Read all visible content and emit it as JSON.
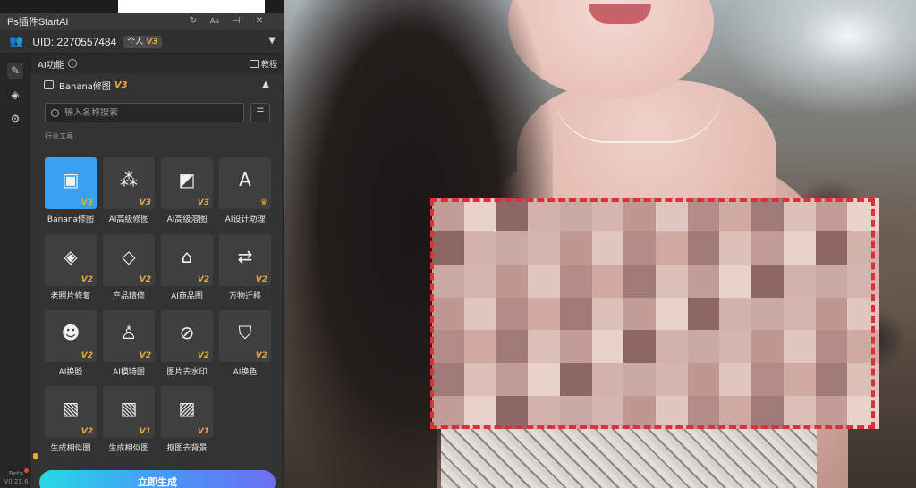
{
  "window": {
    "title": "Ps插件StartAI"
  },
  "user": {
    "uid_label": "UID: 2270557484",
    "plan_label": "个人",
    "plan_version": "V3"
  },
  "ai_panel": {
    "title": "AI功能",
    "info_glyph": "i",
    "tutorial_label": "教程",
    "section_name": "Banana修图",
    "section_version": "V3",
    "search_placeholder": "输入名称搜索",
    "category_label": "行业工具",
    "tools": [
      {
        "label": "Banana修图",
        "version": "V3",
        "icon": "image-edit-icon",
        "glyph": "▣",
        "selected": true
      },
      {
        "label": "AI高级修图",
        "version": "V3",
        "icon": "magic-wand-icon",
        "glyph": "⁂"
      },
      {
        "label": "AI高级溶图",
        "version": "V3",
        "icon": "image-blend-icon",
        "glyph": "◩"
      },
      {
        "label": "AI设计助理",
        "version": "",
        "icon": "design-assistant-icon",
        "glyph": "A"
      },
      {
        "label": "老照片修复",
        "version": "V2",
        "icon": "photo-restore-icon",
        "glyph": "◈"
      },
      {
        "label": "产品精修",
        "version": "V2",
        "icon": "diamond-icon",
        "glyph": "◇"
      },
      {
        "label": "AI商品图",
        "version": "V2",
        "icon": "shopping-bag-icon",
        "glyph": "⌂"
      },
      {
        "label": "万物迁移",
        "version": "V2",
        "icon": "transfer-icon",
        "glyph": "⇄"
      },
      {
        "label": "AI换脸",
        "version": "V2",
        "icon": "face-swap-icon",
        "glyph": "☻"
      },
      {
        "label": "AI模特图",
        "version": "V2",
        "icon": "model-icon",
        "glyph": "♙"
      },
      {
        "label": "图片去水印",
        "version": "V2",
        "icon": "remove-watermark-icon",
        "glyph": "⊘"
      },
      {
        "label": "AI换色",
        "version": "V2",
        "icon": "tshirt-recolor-icon",
        "glyph": "⛉"
      },
      {
        "label": "生成相似图",
        "version": "V2",
        "icon": "similar-image-icon",
        "glyph": "▧"
      },
      {
        "label": "生成相似图",
        "version": "V1",
        "icon": "similar-image-v1-icon",
        "glyph": "▧"
      },
      {
        "label": "抠图去背景",
        "version": "V1",
        "icon": "remove-background-icon",
        "glyph": "▨"
      }
    ],
    "generate_label": "立即生成"
  },
  "rail": {
    "badge": "Beta",
    "version": "V0.21.6"
  },
  "colors": {
    "accent": "#3aa1f2",
    "version_gold": "#e7a92f",
    "selection_red": "#e0282f",
    "mosaic_dash": "#d9323a"
  }
}
